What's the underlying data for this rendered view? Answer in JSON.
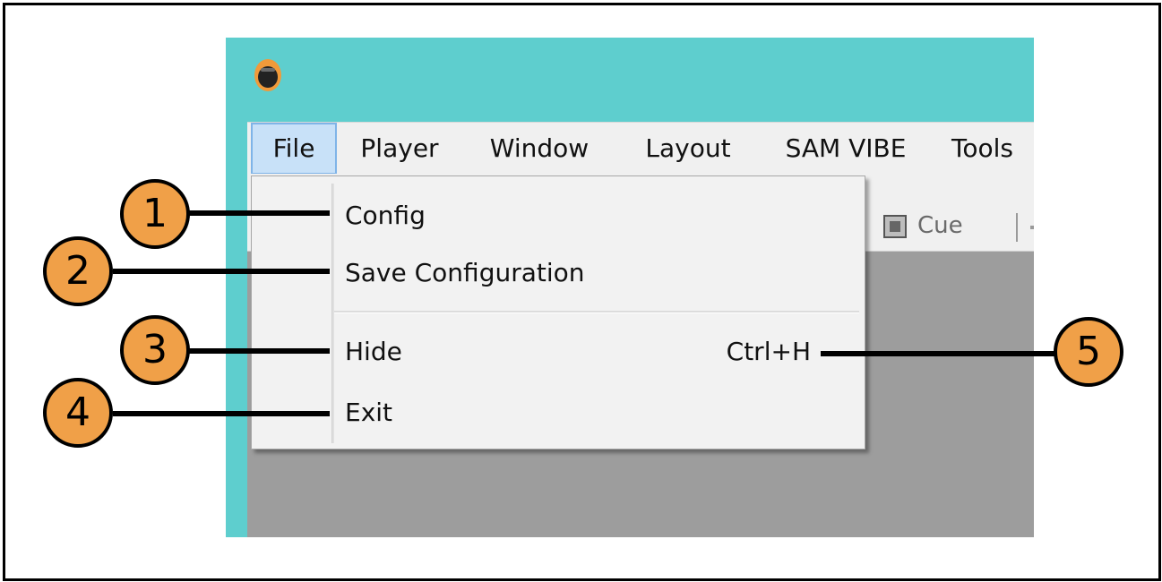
{
  "menubar": {
    "items": [
      "File",
      "Player",
      "Window",
      "Layout",
      "SAM VIBE",
      "Tools"
    ]
  },
  "toolbar": {
    "cue_label": "Cue"
  },
  "file_menu": {
    "items": [
      {
        "label": "Config",
        "shortcut": ""
      },
      {
        "label": "Save Configuration",
        "shortcut": ""
      },
      {
        "label": "Hide",
        "shortcut": "Ctrl+H"
      },
      {
        "label": "Exit",
        "shortcut": ""
      }
    ]
  },
  "callouts": [
    "1",
    "2",
    "3",
    "4",
    "5"
  ],
  "colors": {
    "window_frame": "#5ecece",
    "callout_fill": "#f0a048",
    "menu_active": "#c8e1f8"
  }
}
